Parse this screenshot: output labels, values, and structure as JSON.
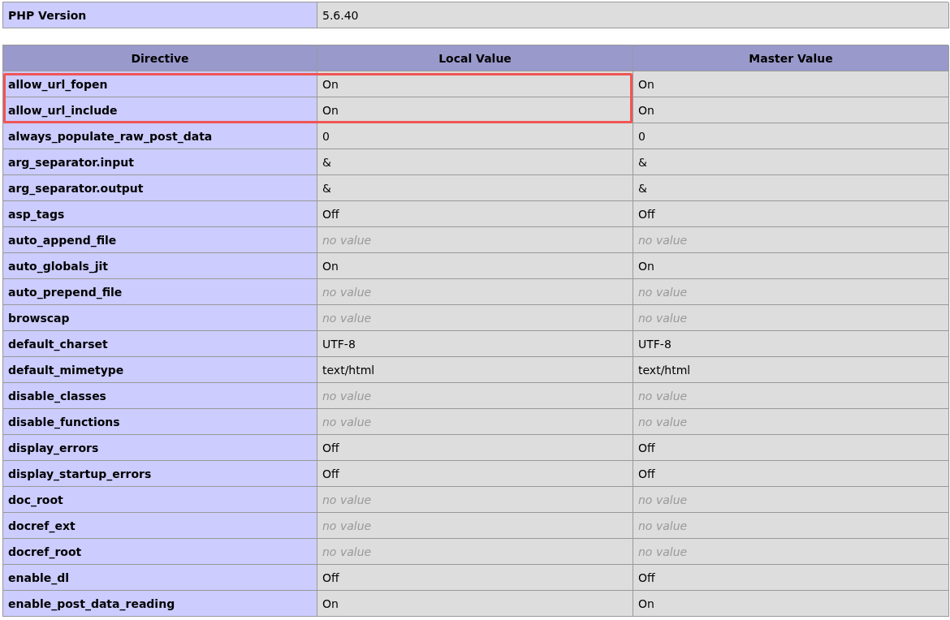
{
  "summary": {
    "label": "PHP Version",
    "value": "5.6.40"
  },
  "table": {
    "columns": [
      "Directive",
      "Local Value",
      "Master Value"
    ],
    "rows": [
      {
        "directive": "allow_url_fopen",
        "local": "On",
        "master": "On",
        "highlighted": true
      },
      {
        "directive": "allow_url_include",
        "local": "On",
        "master": "On",
        "highlighted": true
      },
      {
        "directive": "always_populate_raw_post_data",
        "local": "0",
        "master": "0",
        "highlighted": false
      },
      {
        "directive": "arg_separator.input",
        "local": "&",
        "master": "&",
        "highlighted": false
      },
      {
        "directive": "arg_separator.output",
        "local": "&",
        "master": "&",
        "highlighted": false
      },
      {
        "directive": "asp_tags",
        "local": "Off",
        "master": "Off",
        "highlighted": false
      },
      {
        "directive": "auto_append_file",
        "local": "no value",
        "master": "no value",
        "kind": "empty",
        "highlighted": false
      },
      {
        "directive": "auto_globals_jit",
        "local": "On",
        "master": "On",
        "highlighted": false
      },
      {
        "directive": "auto_prepend_file",
        "local": "no value",
        "master": "no value",
        "kind": "empty",
        "highlighted": false
      },
      {
        "directive": "browscap",
        "local": "no value",
        "master": "no value",
        "kind": "empty",
        "highlighted": false
      },
      {
        "directive": "default_charset",
        "local": "UTF-8",
        "master": "UTF-8",
        "highlighted": false
      },
      {
        "directive": "default_mimetype",
        "local": "text/html",
        "master": "text/html",
        "highlighted": false
      },
      {
        "directive": "disable_classes",
        "local": "no value",
        "master": "no value",
        "kind": "empty",
        "highlighted": false
      },
      {
        "directive": "disable_functions",
        "local": "no value",
        "master": "no value",
        "kind": "empty",
        "highlighted": false
      },
      {
        "directive": "display_errors",
        "local": "Off",
        "master": "Off",
        "highlighted": false
      },
      {
        "directive": "display_startup_errors",
        "local": "Off",
        "master": "Off",
        "highlighted": false
      },
      {
        "directive": "doc_root",
        "local": "no value",
        "master": "no value",
        "kind": "empty",
        "highlighted": false
      },
      {
        "directive": "docref_ext",
        "local": "no value",
        "master": "no value",
        "kind": "empty",
        "highlighted": false
      },
      {
        "directive": "docref_root",
        "local": "no value",
        "master": "no value",
        "kind": "empty",
        "highlighted": false
      },
      {
        "directive": "enable_dl",
        "local": "Off",
        "master": "Off",
        "highlighted": false
      },
      {
        "directive": "enable_post_data_reading",
        "local": "On",
        "master": "On",
        "highlighted": false
      }
    ]
  }
}
